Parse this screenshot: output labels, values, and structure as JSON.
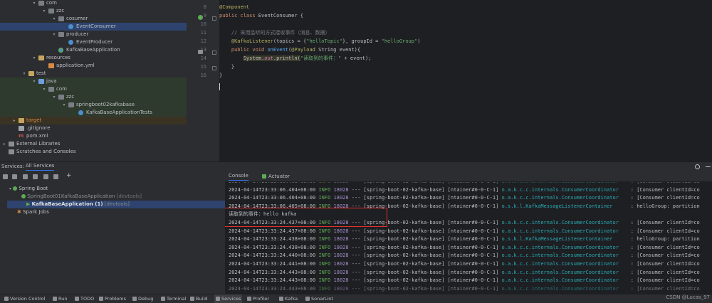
{
  "project_tree": [
    {
      "label": "com",
      "indent": 1,
      "icon": "pkg",
      "arrow": "down"
    },
    {
      "label": "zzc",
      "indent": 2,
      "icon": "pkg",
      "arrow": "down"
    },
    {
      "label": "cosumer",
      "indent": 3,
      "icon": "pkg",
      "arrow": "down"
    },
    {
      "label": "EventConsumer",
      "indent": 4,
      "icon": "cls",
      "arrow": "",
      "selected": true
    },
    {
      "label": "producer",
      "indent": 3,
      "icon": "pkg",
      "arrow": "down"
    },
    {
      "label": "EventProducer",
      "indent": 4,
      "icon": "cls",
      "arrow": ""
    },
    {
      "label": "KafkaBaseApplication",
      "indent": 3,
      "icon": "cls-spring",
      "arrow": ""
    },
    {
      "label": "resources",
      "indent": 1,
      "icon": "folder",
      "arrow": "down"
    },
    {
      "label": "application.yml",
      "indent": 2,
      "icon": "yaml",
      "arrow": ""
    },
    {
      "label": "test",
      "indent": 0,
      "icon": "folder",
      "arrow": "down"
    },
    {
      "label": "java",
      "indent": 1,
      "icon": "folder-blue",
      "arrow": "down",
      "green": true
    },
    {
      "label": "com",
      "indent": 2,
      "icon": "pkg",
      "arrow": "down",
      "green": true
    },
    {
      "label": "zzc",
      "indent": 3,
      "icon": "pkg",
      "arrow": "down",
      "green": true
    },
    {
      "label": "springboot02kafkabase",
      "indent": 4,
      "icon": "pkg",
      "arrow": "down",
      "green": true
    },
    {
      "label": "KafkaBaseApplicationTests",
      "indent": 5,
      "icon": "cls",
      "arrow": "",
      "green": true
    },
    {
      "label": "target",
      "indent": -1,
      "icon": "folder",
      "arrow": "right",
      "target": true
    },
    {
      "label": ".gitignore",
      "indent": -1,
      "icon": "file",
      "arrow": ""
    },
    {
      "label": "pom.xml",
      "indent": -1,
      "icon": "maven",
      "arrow": ""
    },
    {
      "label": "External Libraries",
      "indent": -2,
      "icon": "lib",
      "arrow": "right"
    },
    {
      "label": "Scratches and Consoles",
      "indent": -2,
      "icon": "lib",
      "arrow": ""
    }
  ],
  "editor": {
    "line_numbers": [
      "8",
      "9",
      "10",
      "11",
      "12",
      "13",
      "14",
      "15",
      "16"
    ],
    "lines": [
      [
        {
          "t": "ann",
          "v": "@Component"
        }
      ],
      [
        {
          "t": "kw",
          "v": "public class "
        },
        {
          "t": "plain",
          "v": "EventConsumer {"
        }
      ],
      [],
      [
        {
          "t": "plain",
          "v": "    "
        },
        {
          "t": "cmt",
          "v": "// 采用监听的方式接收事件（消息、数据）"
        }
      ],
      [
        {
          "t": "plain",
          "v": "    "
        },
        {
          "t": "ann",
          "v": "@KafkaListener"
        },
        {
          "t": "plain",
          "v": "(topics = {"
        },
        {
          "t": "str",
          "v": "\"helloTopic\""
        },
        {
          "t": "plain",
          "v": "}, groupId = "
        },
        {
          "t": "str",
          "v": "\"helloGroup\""
        },
        {
          "t": "plain",
          "v": ")"
        }
      ],
      [
        {
          "t": "plain",
          "v": "    "
        },
        {
          "t": "kw",
          "v": "public void "
        },
        {
          "t": "fn",
          "v": "onEvent"
        },
        {
          "t": "plain",
          "v": "("
        },
        {
          "t": "ann",
          "v": "@Payload "
        },
        {
          "t": "plain",
          "v": "String event){"
        }
      ],
      [
        {
          "t": "plain",
          "v": "        "
        },
        {
          "t": "plain",
          "v": "System."
        },
        {
          "t": "fld",
          "v": "out"
        },
        {
          "t": "plain",
          "v": ".println("
        },
        {
          "t": "str",
          "v": "\"读取到的事件：\""
        },
        {
          "t": "plain",
          "v": " + event);"
        }
      ],
      [
        {
          "t": "plain",
          "v": "    }"
        }
      ],
      [
        {
          "t": "plain",
          "v": "}"
        }
      ]
    ]
  },
  "services": {
    "header_label": "Services:",
    "tab_all": "All Services",
    "tree": [
      {
        "label": "Spring Boot",
        "suffix": ""
      },
      {
        "label": "SpringBoot01KafkaBaseApplication",
        "suffix": "[devtools]"
      },
      {
        "label": "KafkaBaseApplication (1)",
        "suffix": "[devtools]"
      },
      {
        "label": "Spark Jobs",
        "suffix": ""
      }
    ]
  },
  "console_tabs": {
    "console": "Console",
    "actuator": "Actuator"
  },
  "console_lines": [
    {
      "ts": "2024-04-14T23:33:06.403+08:00",
      "lvl": "INFO",
      "pid": "18028",
      "thr": "--- [spring-boot-02-kafka-base] [ntainer#0-0-C-1]",
      "cls": "o.a.k.c.c.internals.ConsumerCoordinator ",
      "msg": "  : [Consumer clientId=co",
      "cut": true
    },
    {
      "ts": "2024-04-14T23:33:06.404+08:00",
      "lvl": "INFO",
      "pid": "18028",
      "thr": "--- [spring-boot-02-kafka-base] [ntainer#0-0-C-1]",
      "cls": "o.a.k.c.c.internals.ConsumerCoordinator ",
      "msg": "  : [Consumer clientId=co"
    },
    {
      "ts": "2024-04-14T23:33:06.404+08:00",
      "lvl": "INFO",
      "pid": "18028",
      "thr": "--- [spring-boot-02-kafka-base] [ntainer#0-0-C-1]",
      "cls": "o.a.k.c.c.internals.ConsumerCoordinator ",
      "msg": "  : [Consumer clientId=co"
    },
    {
      "ts": "2024-04-14T23:33:06.405+08:00",
      "lvl": "INFO",
      "pid": "18028",
      "thr": "--- [spring-boot-02-kafka-base] [ntainer#0-0-C-1]",
      "cls": "o.s.k.l.KafkaMessageListenerContainer   ",
      "msg": "  : helloGroup: partition"
    },
    {
      "plain": "读取到的事件：hello kafka"
    },
    {
      "ts": "2024-04-14T23:33:24.437+08:00",
      "lvl": "INFO",
      "pid": "18028",
      "thr": "--- [spring-boot-02-kafka-base] [ntainer#0-0-C-1]",
      "cls": "o.a.k.c.c.internals.ConsumerCoordinator ",
      "msg": "  : [Consumer clientId=co"
    },
    {
      "ts": "2024-04-14T23:33:24.437+08:00",
      "lvl": "INFO",
      "pid": "18028",
      "thr": "--- [spring-boot-02-kafka-base] [ntainer#0-0-C-1]",
      "cls": "o.a.k.c.c.internals.ConsumerCoordinator ",
      "msg": "  : [Consumer clientId=co"
    },
    {
      "ts": "2024-04-14T23:33:24.438+08:00",
      "lvl": "INFO",
      "pid": "18028",
      "thr": "--- [spring-boot-02-kafka-base] [ntainer#0-0-C-1]",
      "cls": "o.s.k.l.KafkaMessageListenerContainer   ",
      "msg": "  : helloGroup: partition"
    },
    {
      "ts": "2024-04-14T23:33:24.438+08:00",
      "lvl": "INFO",
      "pid": "18028",
      "thr": "--- [spring-boot-02-kafka-base] [ntainer#0-0-C-1]",
      "cls": "o.a.k.c.c.internals.ConsumerCoordinator ",
      "msg": "  : [Consumer clientId=co"
    },
    {
      "ts": "2024-04-14T23:33:24.440+08:00",
      "lvl": "INFO",
      "pid": "18028",
      "thr": "--- [spring-boot-02-kafka-base] [ntainer#0-0-C-1]",
      "cls": "o.a.k.c.c.internals.ConsumerCoordinator ",
      "msg": "  : [Consumer clientId=co"
    },
    {
      "ts": "2024-04-14T23:33:24.441+08:00",
      "lvl": "INFO",
      "pid": "18028",
      "thr": "--- [spring-boot-02-kafka-base] [ntainer#0-0-C-1]",
      "cls": "o.a.k.c.c.internals.ConsumerCoordinator ",
      "msg": "  : [Consumer clientId=co"
    },
    {
      "ts": "2024-04-14T23:33:24.443+08:00",
      "lvl": "INFO",
      "pid": "18028",
      "thr": "--- [spring-boot-02-kafka-base] [ntainer#0-0-C-1]",
      "cls": "o.a.k.c.c.internals.ConsumerCoordinator ",
      "msg": "  : [Consumer clientId=co"
    },
    {
      "ts": "2024-04-14T23:33:24.443+08:00",
      "lvl": "INFO",
      "pid": "18028",
      "thr": "--- [spring-boot-02-kafka-base] [ntainer#0-0-C-1]",
      "cls": "o.a.k.c.c.internals.ConsumerCoordinator ",
      "msg": "  : [Consumer clientId=co"
    },
    {
      "ts": "2024-04-14T23:33:24.443+08:00",
      "lvl": "INFO",
      "pid": "18028",
      "thr": "--- [spring-boot-02-kafka-base] [ntainer#0-0-C-1]",
      "cls": "o.a.k.c.c.internals.ConsumerCoordinator ",
      "msg": "  : [Consumer clientId=co",
      "cut": true
    }
  ],
  "status_bar": [
    {
      "label": "Version Control",
      "icon": "branch-icon"
    },
    {
      "label": "Run",
      "icon": "run-icon"
    },
    {
      "label": "TODO",
      "icon": "todo-icon"
    },
    {
      "label": "Problems",
      "icon": "problems-icon"
    },
    {
      "label": "Debug",
      "icon": "debug-icon"
    },
    {
      "label": "Terminal",
      "icon": "terminal-icon"
    },
    {
      "label": "Build",
      "icon": "build-icon"
    },
    {
      "label": "Services",
      "icon": "services-icon",
      "active": true
    },
    {
      "label": "Profiler",
      "icon": "profiler-icon"
    },
    {
      "label": "Kafka",
      "icon": "kafka-icon"
    },
    {
      "label": "SonarLint",
      "icon": "sonarlint-icon"
    }
  ],
  "watermark": "CSDN @Lucas_97",
  "colors": {
    "red_box": "#e0302b",
    "selection": "#2e436e",
    "info": "#5faa57"
  }
}
